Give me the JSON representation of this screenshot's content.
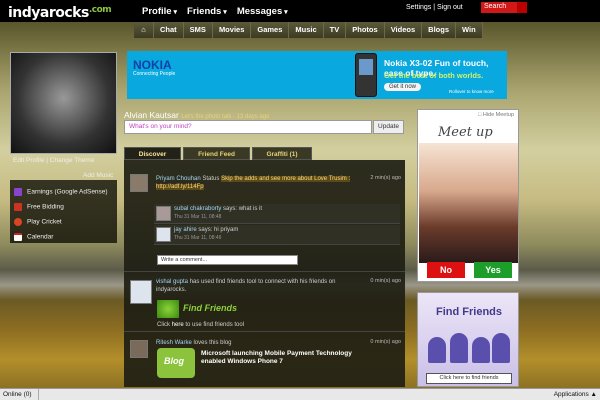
{
  "header": {
    "logo": "indyarocks",
    "logo_suffix": ".com",
    "nav": [
      "Profile",
      "Friends",
      "Messages"
    ],
    "settings": "Settings",
    "signout": "Sign out",
    "search_label": "Search"
  },
  "subnav": [
    "Chat",
    "SMS",
    "Movies",
    "Games",
    "Music",
    "TV",
    "Photos",
    "Videos",
    "Blogs",
    "Win"
  ],
  "ad": {
    "brand": "NOKIA",
    "brand_tag": "Connecting People",
    "headline": "Nokia X3-02 Fun of touch, ease of type.",
    "subhead": "Get the best of both worlds.",
    "cta": "Get it now",
    "rollover": "Rollover to know more"
  },
  "sidebar": {
    "edit_profile": "Edit Profile",
    "change_theme": "Change Theme",
    "add_music": "Add Music",
    "items": [
      "Earnings (Google AdSense)",
      "Free Bidding",
      "Play Cricket",
      "Calendar"
    ],
    "item_colors": [
      "#8844cc",
      "#cc3322",
      "#dd4422",
      "#ffffff"
    ]
  },
  "status": {
    "username": "Alvian Kautsar",
    "meta": "Let's the photo talk - 13 days ago",
    "placeholder": "What's on your mind?",
    "update": "Update"
  },
  "tabs": [
    "Discover",
    "Friend Feed",
    "Graffiti (1)"
  ],
  "feed": {
    "post1": {
      "name": "Priyam Chouhan",
      "action": "Status",
      "text": "Skip the adds and see more about Love Trusim : http://adf.ly/114Fp",
      "time": "2 min(s) ago",
      "c1_name": "subal chakraborty",
      "c1_text": "says: what is it",
      "c1_time": "Thu 31 Mar 11, 08:48",
      "c2_name": "jay ahire",
      "c2_text": "says: hi priyam",
      "c2_time": "Thu 31 Mar 11, 08:49",
      "comment_placeholder": "Write a comment..."
    },
    "post2": {
      "name": "vishal gupta",
      "text": "has used find friends tool to connect with his friends on indyarocks.",
      "time": "0 min(s) ago",
      "tool": "Find Friends",
      "link_pre": "Click",
      "link": "here",
      "link_post": "to use find friends tool"
    },
    "post3": {
      "name": "Ritesh Warke",
      "text": "loves this blog",
      "time": "0 min(s) ago",
      "blog_label": "Blog",
      "blog_title": "Microsoft launching Mobile Payment Technology enabled Windows Phone 7"
    }
  },
  "meetup": {
    "hide": "Hide Meetup",
    "title": "Meet up",
    "no": "No",
    "yes": "Yes"
  },
  "findfriends": {
    "title": "Find Friends",
    "button": "Click here to find friends"
  },
  "statusbar": {
    "online": "Online (0)",
    "apps": "Applications"
  }
}
